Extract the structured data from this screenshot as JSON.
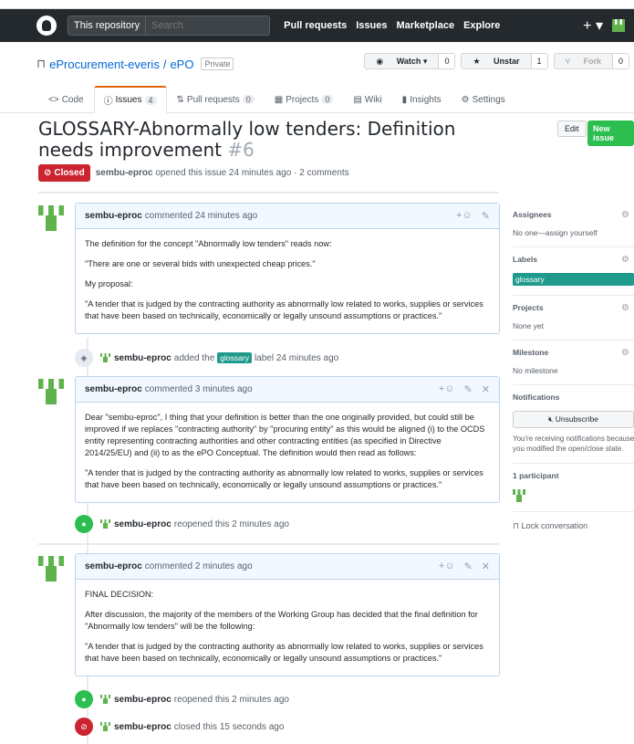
{
  "header": {
    "scope": "This repository",
    "search_placeholder": "Search",
    "nav": [
      "Pull requests",
      "Issues",
      "Marketplace",
      "Explore"
    ],
    "plus": "+ ▾"
  },
  "repo": {
    "owner": "eProcurement-everis",
    "separator": "/",
    "name": "ePO",
    "visibility": "Private",
    "watch": {
      "label": "Watch ▾",
      "count": "0"
    },
    "unstar": {
      "label": "Unstar",
      "count": "1"
    },
    "fork": {
      "label": "Fork",
      "count": "0"
    },
    "tabs": [
      {
        "icon": "<>",
        "label": "Code",
        "count": ""
      },
      {
        "icon": "ⓘ",
        "label": "Issues",
        "count": "4"
      },
      {
        "icon": "⇅",
        "label": "Pull requests",
        "count": "0"
      },
      {
        "icon": "▦",
        "label": "Projects",
        "count": "0"
      },
      {
        "icon": "▤",
        "label": "Wiki",
        "count": ""
      },
      {
        "icon": "▮",
        "label": "Insights",
        "count": ""
      },
      {
        "icon": "⚙",
        "label": "Settings",
        "count": ""
      }
    ]
  },
  "issue": {
    "title": "GLOSSARY-Abnormally low tenders: Definition needs improvement",
    "number": "#6",
    "edit_label": "Edit",
    "new_issue_label": "New issue",
    "state": "Closed",
    "author": "sembu-eproc",
    "meta": "opened this issue 24 minutes ago · 2 comments"
  },
  "comments": [
    {
      "author": "sembu-eproc",
      "time": "commented 24 minutes ago",
      "body": [
        "The definition for the concept \"Abnormally low tenders\" reads now:",
        "\"There are one or several bids with unexpected cheap prices.\"",
        "My proposal:",
        "\"A tender that is judged by the contracting authority as abnormally low related to works, supplies or services that have been based on technically, economically or legally unsound assumptions or practices.\""
      ]
    },
    {
      "author": "sembu-eproc",
      "time": "commented 3 minutes ago",
      "body": [
        "Dear \"sembu-eproc\", I thing that your definition is better than the one originally provided, but could still be improved if we replaces \"contracting authority\" by \"procuring entity\" as this would be aligned (i) to the OCDS entity representing contracting authorities and other contracting entities (as specified in Directive 2014/25/EU) and (ii) to as the ePO Conceptual. The definition would then read as follows:",
        "\"A tender that is judged by the contracting authority as abnormally low related to works, supplies or services that have been based on technically, economically or legally unsound assumptions or practices.\""
      ]
    },
    {
      "author": "sembu-eproc",
      "time": "commented 2 minutes ago",
      "body": [
        "FINAL DECISION:",
        "After discussion, the majority of the members of the Working Group has decided that the final definition for \"Abnormally low tenders\" will be the following:",
        "\"A tender that is judged by the contracting authority as abnormally low related to works, supplies or services that have been based on technically, economically or legally unsound assumptions or practices.\""
      ]
    }
  ],
  "events": [
    {
      "author": "sembu-eproc",
      "pre": "added the",
      "label": "glossary",
      "post": "label 24 minutes ago"
    },
    {
      "author": "sembu-eproc",
      "text": "reopened this 2 minutes ago"
    },
    {
      "author": "sembu-eproc",
      "text": "reopened this 2 minutes ago"
    },
    {
      "author": "sembu-eproc",
      "text": "closed this 15 seconds ago"
    }
  ],
  "sidebar": {
    "assignees": {
      "title": "Assignees",
      "value": "No one—assign yourself"
    },
    "labels": {
      "title": "Labels",
      "value": "glossary"
    },
    "projects": {
      "title": "Projects",
      "value": "None yet"
    },
    "milestone": {
      "title": "Milestone",
      "value": "No milestone"
    },
    "notifications": {
      "title": "Notifications",
      "button": "Unsubscribe",
      "note": [
        "You're receiving notifications because",
        "you modified the open/close state."
      ]
    },
    "participants": "1 participant",
    "lock": "Lock conversation"
  },
  "colors": {
    "header": "#24292e",
    "closed": "#cb2431",
    "open": "#2cbe4e",
    "label_glossary": "#1f9a8d"
  }
}
